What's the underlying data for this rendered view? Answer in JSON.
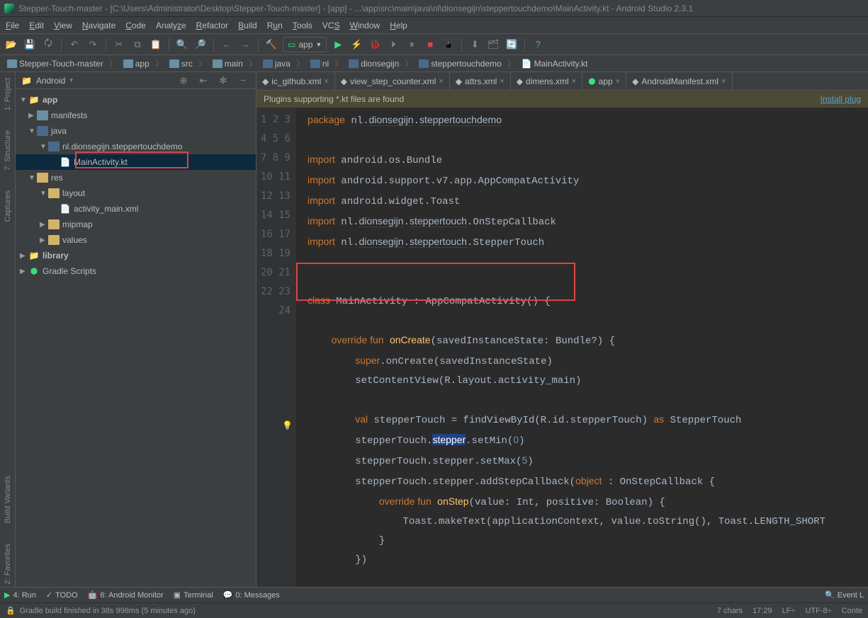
{
  "title": "Stepper-Touch-master - [C:\\Users\\Administrator\\Desktop\\Stepper-Touch-master] - [app] - ...\\app\\src\\main\\java\\nl\\dionsegijn\\steppertouchdemo\\MainActivity.kt - Android Studio 2.3.1",
  "menu": [
    "File",
    "Edit",
    "View",
    "Navigate",
    "Code",
    "Analyze",
    "Refactor",
    "Build",
    "Run",
    "Tools",
    "VCS",
    "Window",
    "Help"
  ],
  "runconfig": "app",
  "breadcrumbs": [
    "Stepper-Touch-master",
    "app",
    "src",
    "main",
    "java",
    "nl",
    "dionsegijn",
    "steppertouchdemo",
    "MainActivity.kt"
  ],
  "project_mode": "Android",
  "tree": {
    "app": "app",
    "manifests": "manifests",
    "java": "java",
    "pkg": "nl.dionsegijn.steppertouchdemo",
    "mainact": "MainActivity.kt",
    "res": "res",
    "layout": "layout",
    "actmain": "activity_main.xml",
    "mipmap": "mipmap",
    "values": "values",
    "library": "library",
    "gradle": "Gradle Scripts"
  },
  "tabs": [
    {
      "label": "ic_github.xml"
    },
    {
      "label": "view_step_counter.xml"
    },
    {
      "label": "attrs.xml"
    },
    {
      "label": "dimens.xml"
    },
    {
      "label": "app"
    },
    {
      "label": "AndroidManifest.xml"
    }
  ],
  "banner_text": "Plugins supporting *.kt files are found",
  "banner_link": "Install plug",
  "code_lines": 25,
  "bottom": {
    "run": "4: Run",
    "todo": "TODO",
    "monitor": "6: Android Monitor",
    "terminal": "Terminal",
    "messages": "0: Messages",
    "eventlog": "Event L"
  },
  "status": {
    "msg": "Gradle build finished in 38s 996ms (5 minutes ago)",
    "chars": "7 chars",
    "time": "17:29",
    "lf": "LF÷",
    "enc": "UTF-8÷",
    "ctx": "Conte"
  },
  "sidestrip": {
    "project": "1: Project",
    "structure": "7: Structure",
    "captures": "Captures",
    "build": "Build Variants",
    "fav": "2: Favorites"
  }
}
